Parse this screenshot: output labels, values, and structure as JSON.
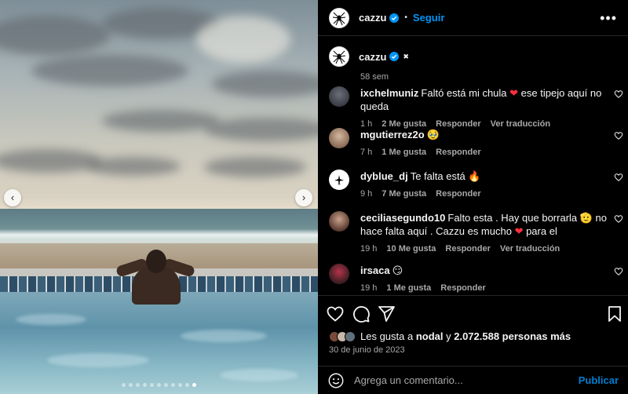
{
  "post": {
    "username": "cazzu",
    "follow_label": "Seguir",
    "separator": "•",
    "more_label": "•••",
    "caption_emoji": "✖",
    "caption_time": "58 sem"
  },
  "carousel": {
    "prev_label": "‹",
    "next_label": "›",
    "slide_count": 11,
    "active_slide": 10
  },
  "comments": [
    {
      "username": "ixchelmuniz",
      "text_parts": [
        "Faltó está mi chula ",
        "❤",
        " ese tipejo aquí no queda"
      ],
      "time": "1 h",
      "likes": "2 Me gusta",
      "reply_label": "Responder",
      "translate_label": "Ver traducción",
      "avatar": "avatar-ixchelmuniz"
    },
    {
      "username": "mgutierrez2o",
      "text_parts": [
        "🥹"
      ],
      "time": "7 h",
      "likes": "1 Me gusta",
      "reply_label": "Responder",
      "avatar": "avatar-mgutierrez2o"
    },
    {
      "username": "dyblue_dj",
      "text_parts": [
        "Te falta está 🔥"
      ],
      "time": "9 h",
      "likes": "7 Me gusta",
      "reply_label": "Responder",
      "avatar": "avatar-dyblue_dj"
    },
    {
      "username": "ceciliasegundo10",
      "text_parts": [
        "Falto esta . Hay que borrarla 🫡 no hace falta aquí . Cazzu es mucho ",
        "❤",
        " para el"
      ],
      "time": "19 h",
      "likes": "10 Me gusta",
      "reply_label": "Responder",
      "translate_label": "Ver traducción",
      "avatar": "avatar-ceciliasegundo10"
    },
    {
      "username": "irsaca",
      "text_parts": [
        "😏"
      ],
      "time": "19 h",
      "likes": "1 Me gusta",
      "reply_label": "Responder",
      "avatar": "avatar-irsaca"
    }
  ],
  "likes_summary": {
    "prefix": "Les gusta a ",
    "user": "nodal",
    "middle": " y ",
    "count": "2.072.588 personas más"
  },
  "date": "30 de junio de 2023",
  "add_comment": {
    "placeholder": "Agrega un comentario...",
    "publish_label": "Publicar"
  },
  "colors": {
    "accent": "#0095f6",
    "background": "#000000",
    "secondary_text": "#a8a8a8",
    "like_red": "#ff3040"
  },
  "icons": [
    "spider-logo-icon",
    "verified-badge-icon",
    "heart-icon",
    "comment-icon",
    "share-icon",
    "bookmark-icon",
    "emoji-icon",
    "more-options-icon"
  ]
}
